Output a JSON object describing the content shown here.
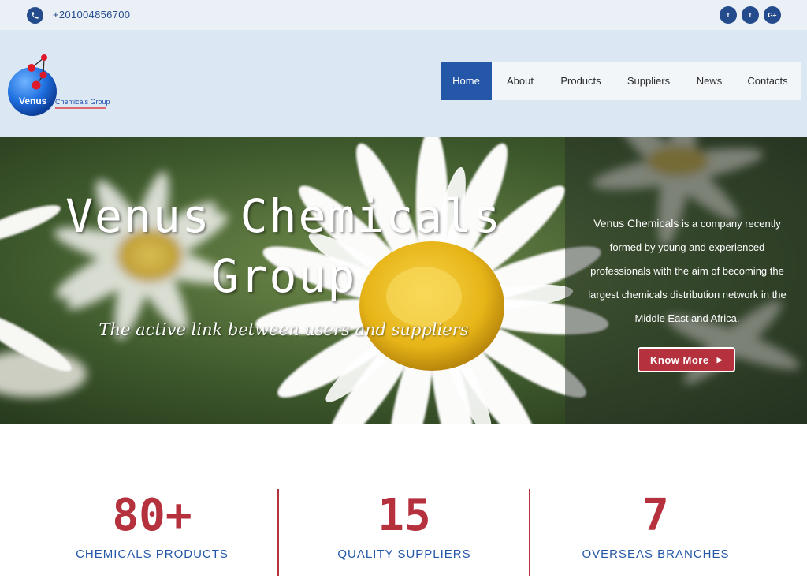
{
  "topbar": {
    "phone": "+201004856700",
    "social": [
      {
        "icon": "facebook-icon",
        "label": "f"
      },
      {
        "icon": "twitter-icon",
        "label": "t"
      },
      {
        "icon": "google-plus-icon",
        "label": "G+"
      }
    ]
  },
  "logo": {
    "word": "Venus",
    "tagline": "Chemicals Group"
  },
  "nav": {
    "items": [
      {
        "label": "Home",
        "active": true
      },
      {
        "label": "About"
      },
      {
        "label": "Products"
      },
      {
        "label": "Suppliers"
      },
      {
        "label": "News"
      },
      {
        "label": "Contacts"
      }
    ]
  },
  "hero": {
    "title_line1": "Venus Chemicals",
    "title_line2": "Group",
    "tagline": "The active link between users and suppliers",
    "desc_brand": "Venus Chemicals",
    "desc_rest": " is a company recently formed by young and experienced professionals with the aim of becoming the largest chemicals distribution network in the Middle East and Africa.",
    "button_label": "Know More",
    "button_icon": "caret-right-icon"
  },
  "stats": [
    {
      "value": "80+",
      "label": "CHEMICALS PRODUCTS"
    },
    {
      "value": "15",
      "label": "QUALITY SUPPLIERS"
    },
    {
      "value": "7",
      "label": "OVERSEAS BRANCHES"
    }
  ],
  "colors": {
    "primary_blue": "#2457a7",
    "accent_red": "#b6313e",
    "topbar_bg": "#eaf0f6",
    "header_bg": "#dbe7f3"
  }
}
